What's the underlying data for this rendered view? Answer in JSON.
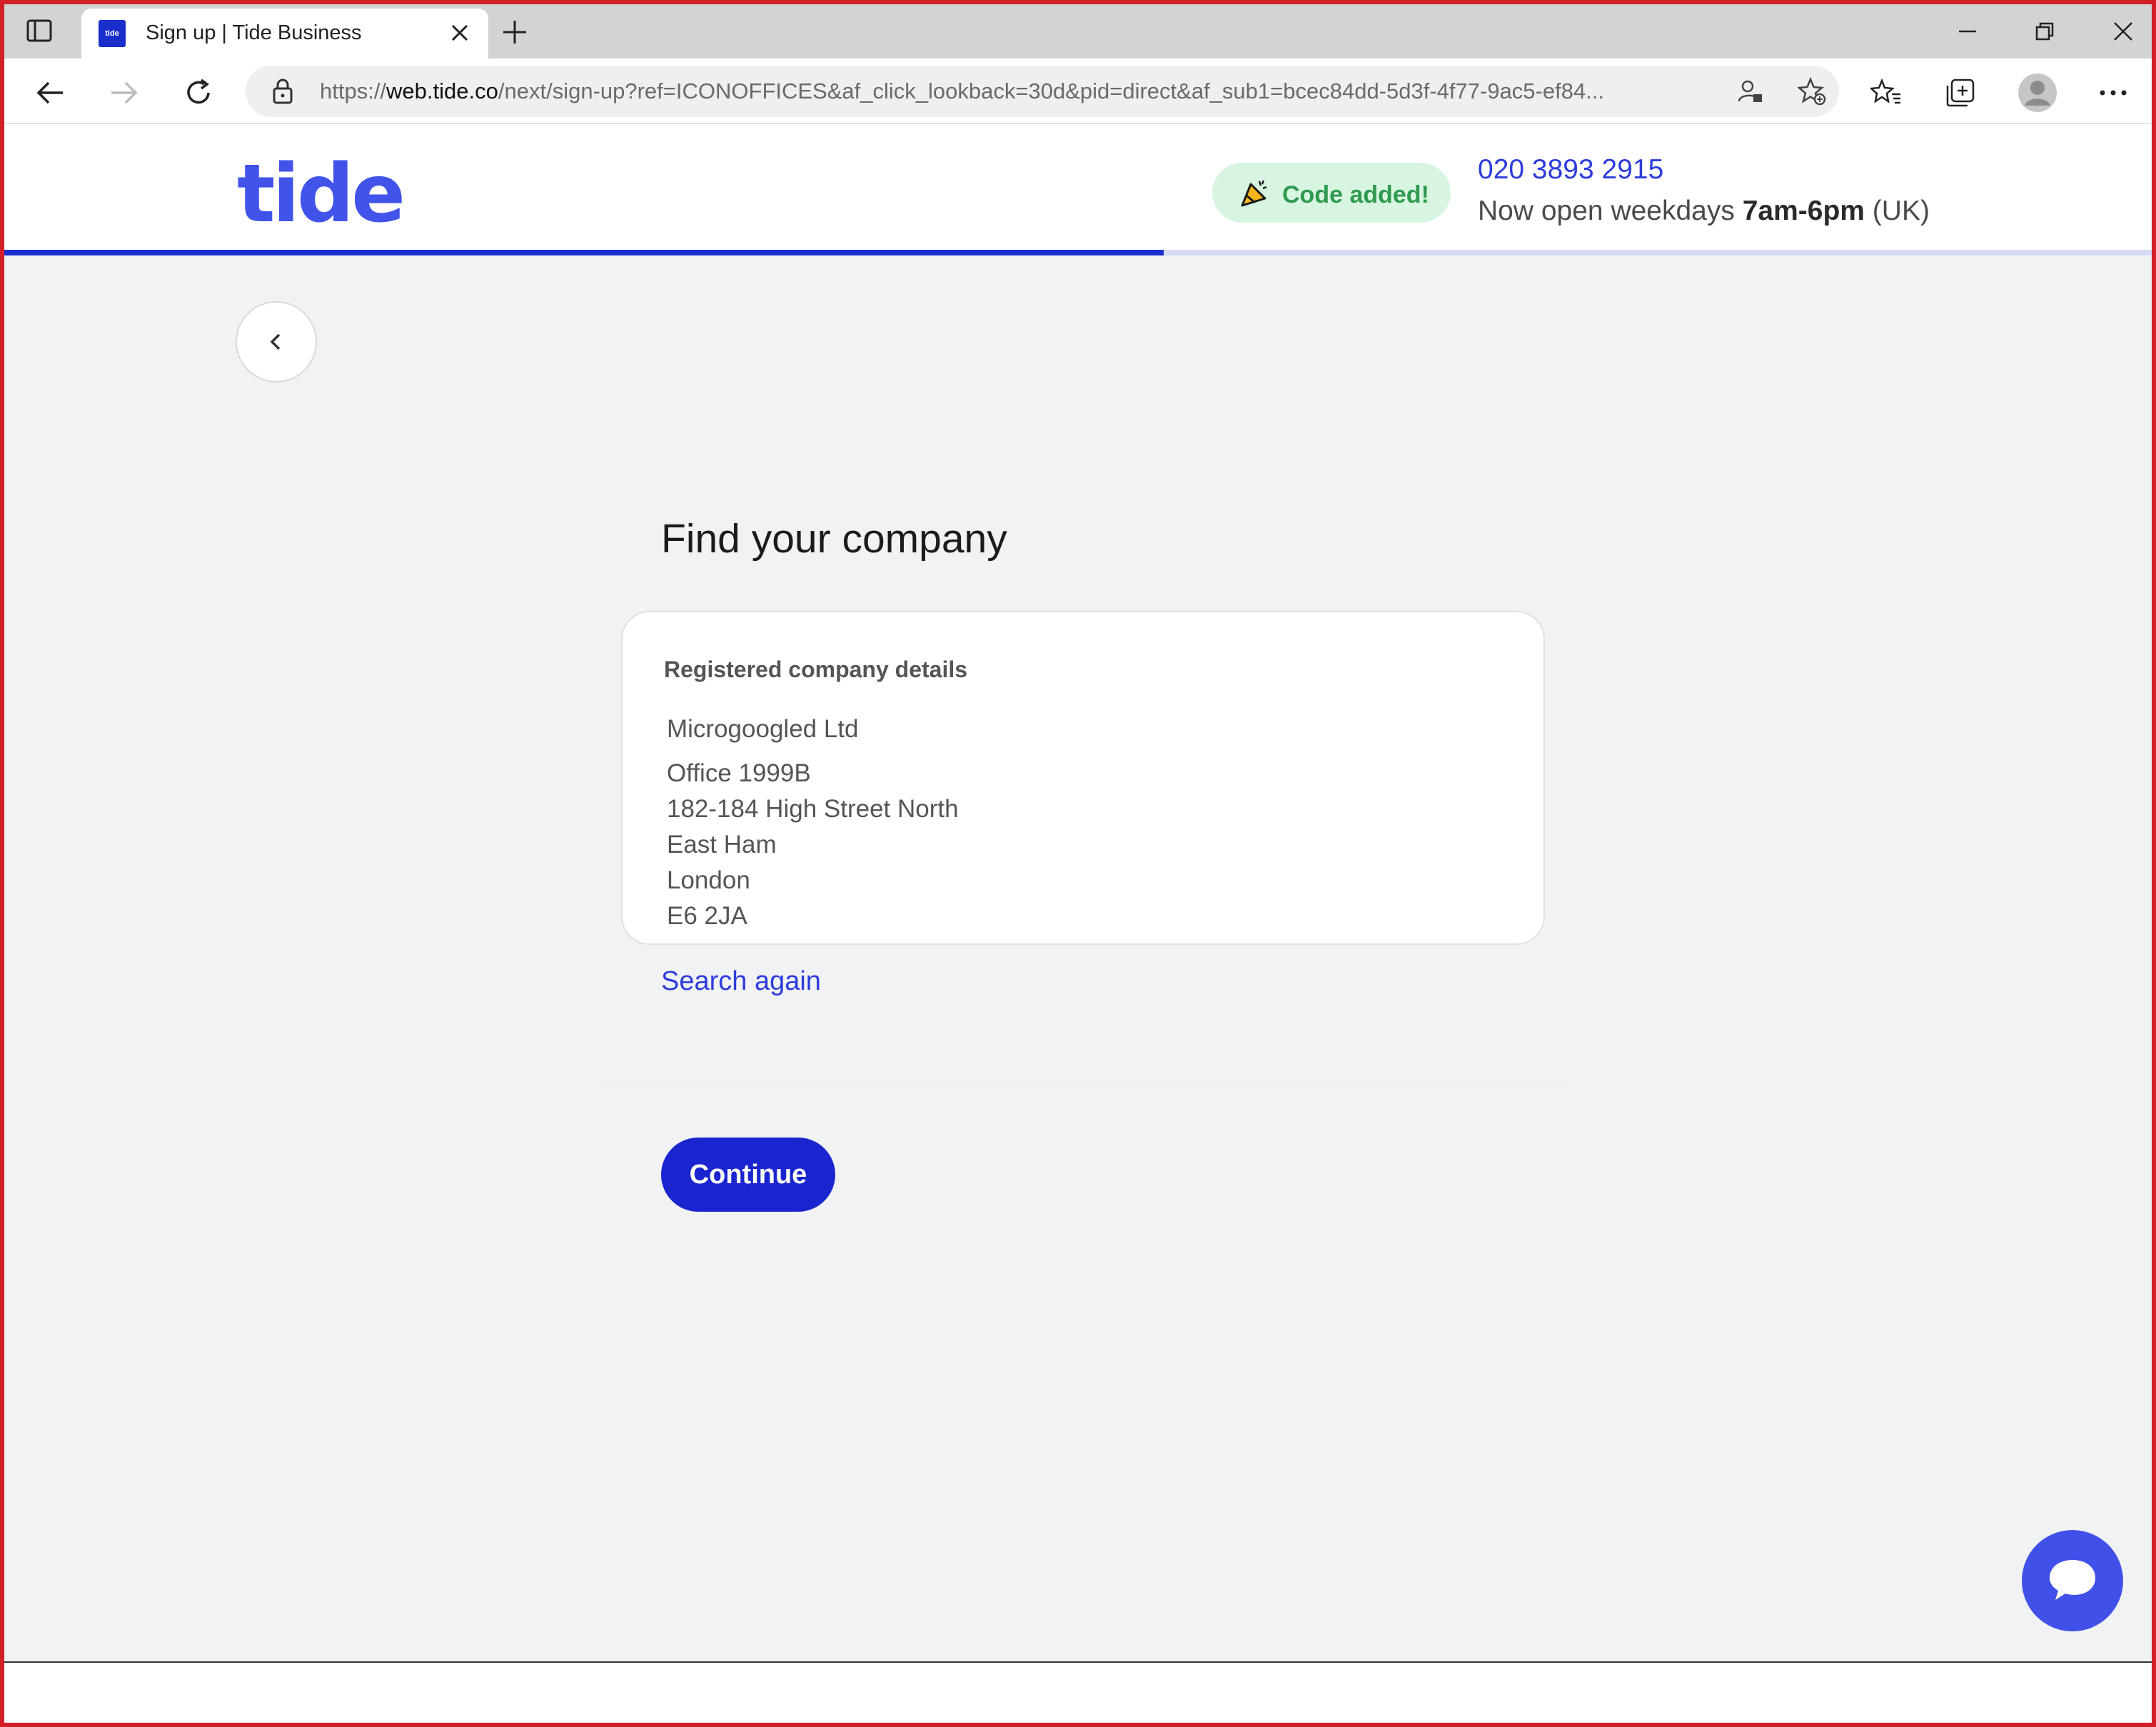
{
  "browser": {
    "tab_title": "Sign up | Tide Business",
    "favicon_text": "tide",
    "url_prefix": "https://",
    "url_host": "web.tide.co",
    "url_path": "/next/sign-up?ref=ICONOFFICES&af_click_lookback=30d&pid=direct&af_sub1=bcec84dd-5d3f-4f77-9ac5-ef84..."
  },
  "header": {
    "logo": "tide",
    "badge": "Code added!",
    "phone": "020 3893 2915",
    "hours_prefix": "Now open weekdays ",
    "hours_bold": "7am-6pm",
    "hours_suffix": " (UK)",
    "progress_fraction": 0.54
  },
  "main": {
    "title": "Find your company",
    "card": {
      "heading": "Registered company details",
      "company_name": "Microgoogled Ltd",
      "address_lines": [
        "Office 1999B",
        "182-184 High Street North",
        "East Ham",
        "London",
        "E6 2JA"
      ]
    },
    "search_again": "Search again",
    "continue_label": "Continue"
  },
  "colors": {
    "brand_blue": "#4153e8",
    "button_blue": "#1a25cf",
    "link_blue": "#2d3cdc",
    "badge_green_bg": "#d8f5e2",
    "badge_green_text": "#2f9a4f"
  }
}
